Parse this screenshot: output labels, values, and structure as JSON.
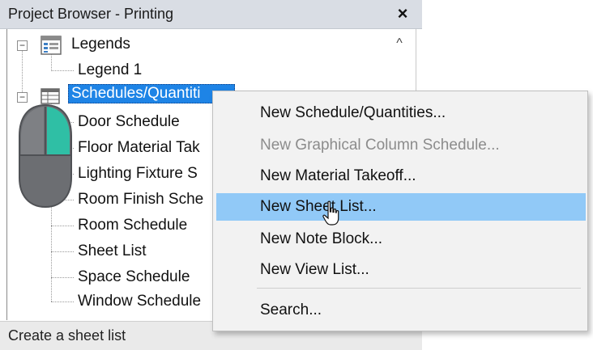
{
  "window": {
    "title": "Project Browser - Printing",
    "close_glyph": "×"
  },
  "scroll": {
    "up_glyph": "^"
  },
  "tree": {
    "legends": {
      "label": "Legends",
      "children": [
        "Legend 1"
      ]
    },
    "schedules": {
      "label": "Schedules/Quantities",
      "label_visible": "Schedules/Quantiti",
      "children": [
        "Door Schedule",
        "Floor Material Tak",
        "Lighting Fixture S",
        "Room Finish Sche",
        "Room Schedule",
        "Sheet List",
        "Space Schedule",
        "Window Schedule"
      ]
    },
    "expander_glyph": "−"
  },
  "status": {
    "text": "Create a sheet list"
  },
  "context_menu": {
    "items": [
      {
        "label": "New Schedule/Quantities...",
        "state": "normal"
      },
      {
        "label": "New Graphical Column Schedule...",
        "state": "disabled"
      },
      {
        "label": "New Material Takeoff...",
        "state": "normal"
      },
      {
        "label": "New Sheet List...",
        "state": "hover"
      },
      {
        "label": "New Note Block...",
        "state": "normal"
      },
      {
        "label": "New View List...",
        "state": "normal"
      },
      {
        "label": "Search...",
        "state": "normal"
      }
    ]
  },
  "colors": {
    "selection": "#1e84e6",
    "menu_hover": "#91c9f7",
    "mouse_body": "#6c6e72",
    "mouse_button": "#2fbfa5"
  },
  "icons": {
    "legends": "legend-view-icon",
    "schedules": "schedule-table-icon",
    "mouse": "right-click-mouse-icon",
    "cursor": "hand-pointer-cursor"
  }
}
